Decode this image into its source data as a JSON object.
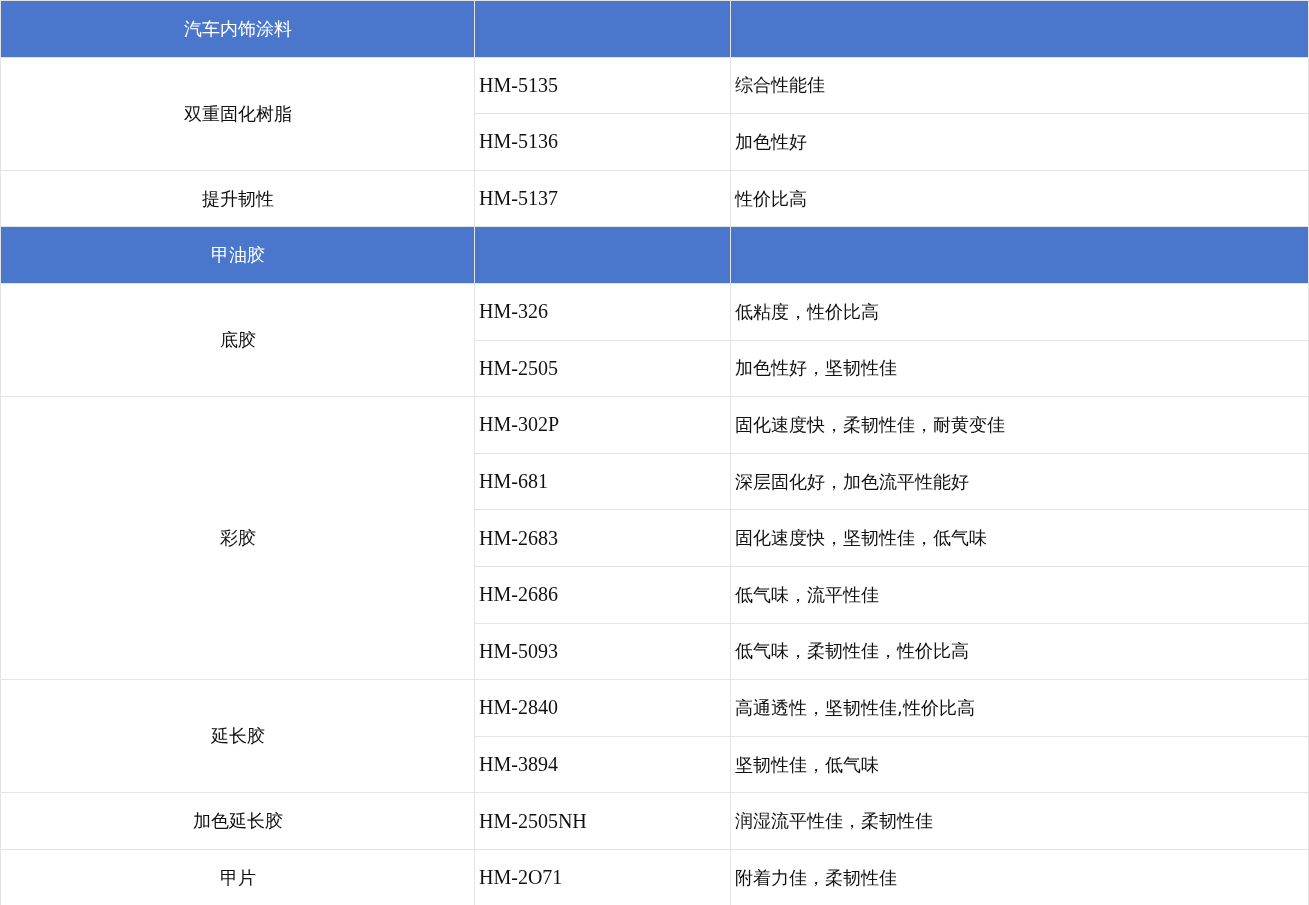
{
  "sections": [
    {
      "title": "汽车内饰涂料",
      "groups": [
        {
          "category": "双重固化树脂",
          "items": [
            {
              "code": "HM-5135",
              "feature": "综合性能佳"
            },
            {
              "code": "HM-5136",
              "feature": "加色性好"
            }
          ]
        },
        {
          "category": "提升韧性",
          "items": [
            {
              "code": "HM-5137",
              "feature": "性价比高"
            }
          ]
        }
      ]
    },
    {
      "title": "甲油胶",
      "groups": [
        {
          "category": "底胶",
          "items": [
            {
              "code": "HM-326",
              "feature": "低粘度，性价比高"
            },
            {
              "code": "HM-2505",
              "feature": "加色性好，坚韧性佳"
            }
          ]
        },
        {
          "category": "彩胶",
          "items": [
            {
              "code": "HM-302P",
              "feature": "固化速度快，柔韧性佳，耐黄变佳"
            },
            {
              "code": "HM-681",
              "feature": "深层固化好，加色流平性能好"
            },
            {
              "code": "HM-2683",
              "feature": "固化速度快，坚韧性佳，低气味"
            },
            {
              "code": "HM-2686",
              "feature": "低气味，流平性佳"
            },
            {
              "code": "HM-5093",
              "feature": "低气味，柔韧性佳，性价比高"
            }
          ]
        },
        {
          "category": "延长胶",
          "items": [
            {
              "code": "HM-2840",
              "feature": "高通透性，坚韧性佳,性价比高"
            },
            {
              "code": "HM-3894",
              "feature": "坚韧性佳，低气味"
            }
          ]
        },
        {
          "category": "加色延长胶",
          "items": [
            {
              "code": "HM-2505NH",
              "feature": "润湿流平性佳，柔韧性佳"
            }
          ]
        },
        {
          "category": "甲片",
          "items": [
            {
              "code": "HM-2O71",
              "feature": "附着力佳，柔韧性佳"
            }
          ]
        }
      ]
    }
  ]
}
